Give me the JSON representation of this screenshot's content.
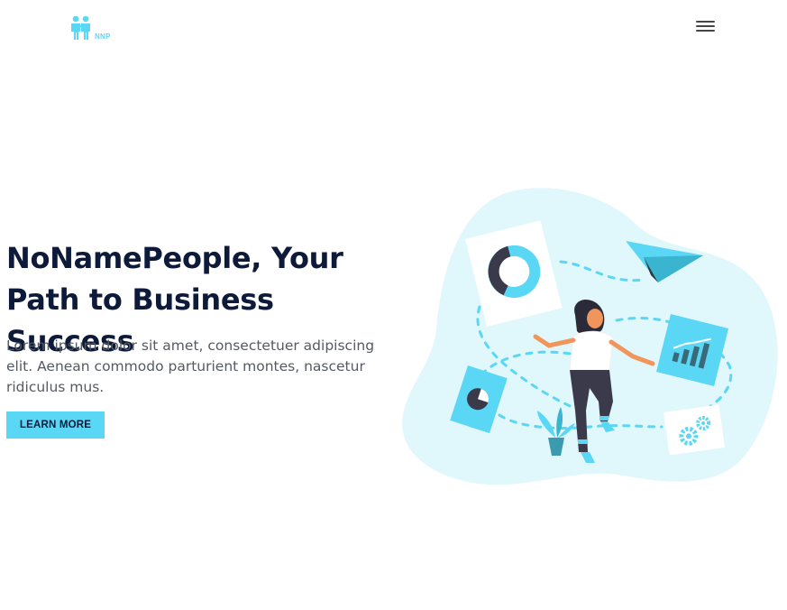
{
  "header": {
    "logo_text": "NNP",
    "logo_icon": "people-icon",
    "menu_icon": "hamburger-menu-icon"
  },
  "hero": {
    "title": "NoNamePeople, Your Path to Business Success",
    "description": "Lorem ipsum dolor sit amet, consectetuer adipiscing elit. Aenean commodo parturient montes, nascetur ridiculus mus.",
    "cta_label": "LEARN MORE"
  },
  "illustration": {
    "icon": "business-woman-illustration"
  },
  "colors": {
    "accent": "#5ad7f5",
    "blob": "#e0f7fc",
    "title": "#0d1a3a",
    "text": "#555a62",
    "dark": "#3a3a4a",
    "skin": "#f0955b"
  }
}
